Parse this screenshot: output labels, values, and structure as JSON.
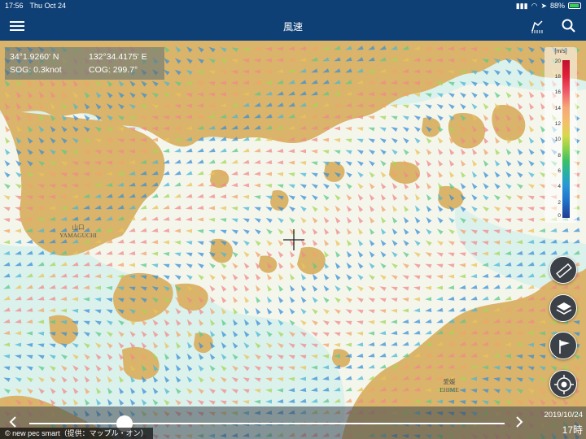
{
  "status_bar": {
    "time": "17:56",
    "date": "Thu Oct 24",
    "battery": "88%",
    "battery_level": 0.88
  },
  "nav": {
    "title": "風速",
    "menu_icon": "hamburger-menu-icon",
    "weather_icon": "weather-icon",
    "search_icon": "search-icon"
  },
  "position": {
    "lat": "34°1.9260' N",
    "lon": "132°34.4175' E",
    "sog": "SOG: 0.3knot",
    "cog": "COG: 299.7°"
  },
  "legend": {
    "unit": "[m/s]",
    "ticks": [
      "20",
      "18",
      "16",
      "14",
      "12",
      "10",
      "8",
      "6",
      "4",
      "2",
      "0"
    ]
  },
  "map_labels": {
    "yamaguchi_jp": "山口",
    "yamaguchi_en": "YAMAGUCHI",
    "ehime_jp": "愛媛",
    "ehime_en": "EHIME"
  },
  "controls": {
    "ruler": "ruler-icon",
    "layers": "layers-icon",
    "flag": "flag-icon",
    "locate": "locate-icon"
  },
  "timeline": {
    "date": "2019/10/24",
    "hour": "17時",
    "progress": 0.2
  },
  "credit": "© new pec smart（提供：マップル・オン）",
  "colors": {
    "navbar": "#0e3f75",
    "land": "#d9b46a",
    "shallow": "#dff2ee",
    "sea": "#f4f6ec"
  }
}
